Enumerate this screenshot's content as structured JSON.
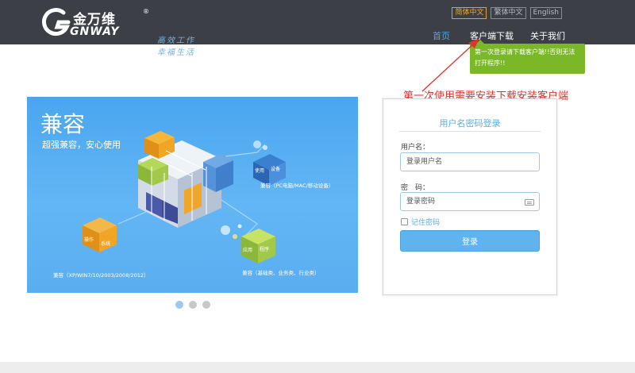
{
  "header": {
    "brand_cn": "金万维",
    "brand_en": "GNWAY",
    "brand_reg": "®",
    "slogan": "高效工作 幸福生活",
    "languages": [
      {
        "label": "简体中文",
        "active": true
      },
      {
        "label": "繁体中文",
        "active": false
      },
      {
        "label": "English",
        "active": false
      }
    ],
    "nav": [
      {
        "label": "首页",
        "active": true
      },
      {
        "label": "客户端下载",
        "active": false
      },
      {
        "label": "关于我们",
        "active": false
      }
    ]
  },
  "tooltip": {
    "line1": "第一次登录请下载客户端!!否则无法",
    "line2": "打开程序!!"
  },
  "annotation": "第一次使用需要安装下载安装客户端",
  "banner": {
    "title": "兼容",
    "subtitle": "超强兼容，安心使用",
    "cube_labels": {
      "device_1": "使用",
      "device_2": "设备",
      "system_1": "操作",
      "system_2": "系统",
      "app_1": "应用",
      "app_2": "程序"
    },
    "captions": {
      "device": "兼容（PC电脑/MAC/移动设备）",
      "system": "兼容（XP/WIN7/10/2003/2008/2012）",
      "app": "兼容（基础类、业务类、行业类）"
    },
    "slides": 3,
    "active_slide": 0
  },
  "login": {
    "title": "用户名密码登录",
    "username_label": "用户名：",
    "username_placeholder": "登录用户名",
    "password_label": "密　码：",
    "password_placeholder": "登录密码",
    "remember_label": "记住密码",
    "submit_label": "登录"
  },
  "colors": {
    "header_bg": "#3c3f45",
    "accent": "#5fb4f0",
    "tooltip_bg": "#7ab828",
    "annotation": "#e0332e",
    "lang_active": "#f0a830"
  }
}
